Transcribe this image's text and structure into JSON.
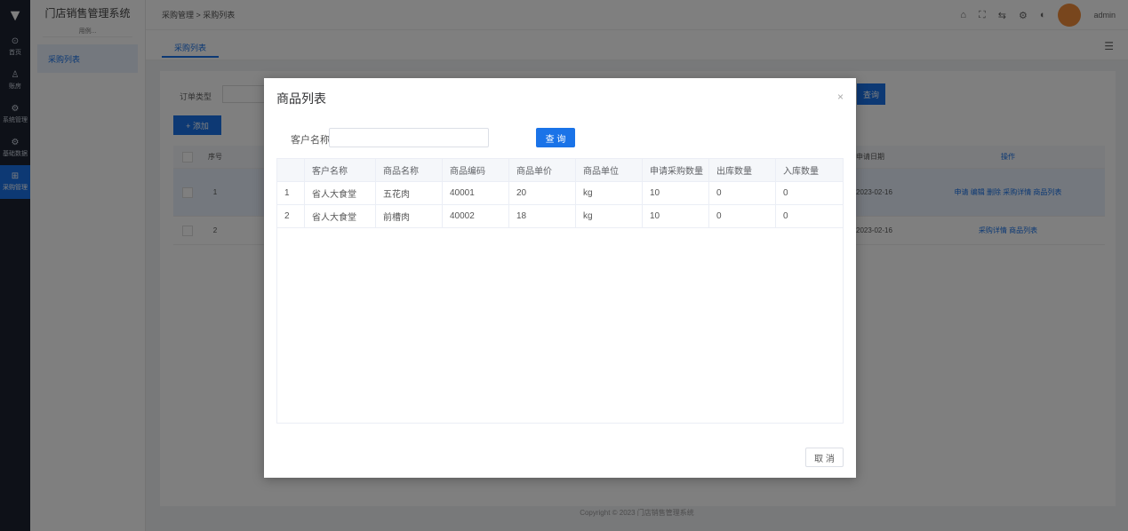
{
  "app": {
    "title": "门店销售管理系统",
    "subtitle": "用例..."
  },
  "rail": {
    "items": [
      {
        "icon": "home-icon",
        "label": "首页"
      },
      {
        "icon": "user-icon",
        "label": "账房"
      },
      {
        "icon": "gear-icon",
        "label": "系统管理"
      },
      {
        "icon": "gear-icon",
        "label": "基础数据"
      },
      {
        "icon": "cart-icon",
        "label": "采购管理"
      }
    ]
  },
  "sidebar": {
    "menu_item": "采购列表"
  },
  "header": {
    "breadcrumb": "采购管理 > 采购列表",
    "username": "admin"
  },
  "tabs": {
    "active": "采购列表"
  },
  "background": {
    "filter_label": "订单类型",
    "search_button": "查询",
    "add_button": "+ 添加",
    "columns": {
      "index": "序号",
      "date": "申请日期",
      "ops": "操作"
    },
    "rows": [
      {
        "index": "1",
        "date": "2023-02-16",
        "ops": "申请  编辑  删除  采购详情  商品列表"
      },
      {
        "index": "2",
        "date": "2023-02-16",
        "ops": "采购详情  商品列表"
      }
    ],
    "footer": "Copyright © 2023 门店销售管理系统"
  },
  "dialog": {
    "title": "商品列表",
    "close": "×",
    "query_label": "客户名称",
    "query_value": "",
    "query_button": "查 询",
    "cancel_button": "取 消",
    "columns": [
      "",
      "客户名称",
      "商品名称",
      "商品编码",
      "商品单价",
      "商品单位",
      "申请采购数量",
      "出库数量",
      "入库数量"
    ],
    "rows": [
      [
        "1",
        "省人大食堂",
        "五花肉",
        "40001",
        "20",
        "kg",
        "10",
        "0",
        "0"
      ],
      [
        "2",
        "省人大食堂",
        "前槽肉",
        "40002",
        "18",
        "kg",
        "10",
        "0",
        "0"
      ]
    ]
  },
  "colors": {
    "primary": "#1a73e8",
    "rail_bg": "#1c2230"
  }
}
